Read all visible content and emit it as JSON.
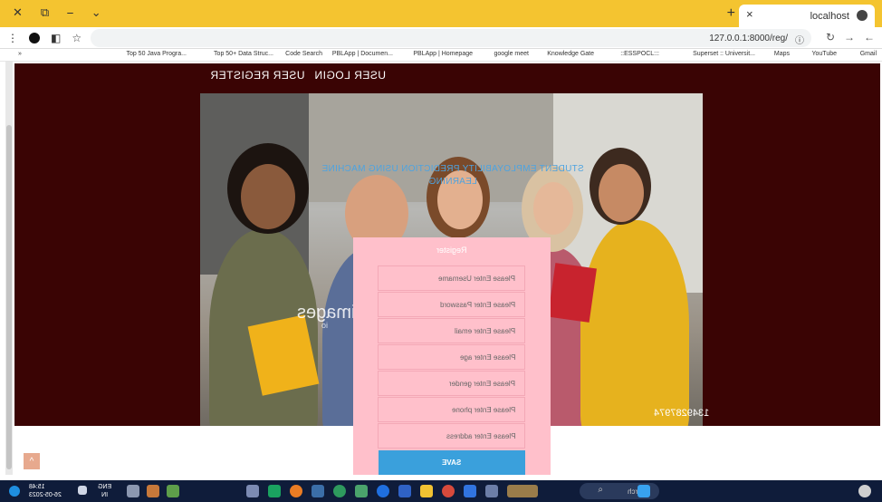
{
  "browser": {
    "tab_title": "localhost",
    "url": "127.0.0.1:8000/reg/",
    "new_tab": "+",
    "close_tab": "×",
    "window_controls": [
      "✕",
      "⎯",
      "⌄"
    ],
    "bookmarks": [
      "Gmail",
      "YouTube",
      "Maps",
      "Superset :: Universit...",
      "::ESSPOCL:::",
      "Knowledge Gate",
      "google meet",
      "PBLApp | Homepage",
      "PBLApp | Documen...",
      "Code Search",
      "Top 50+ Data Struc...",
      "Top 50 Java Progra...",
      "»"
    ]
  },
  "nav": {
    "menu_items": [
      "USER LOGIN",
      "USER REGISTER"
    ]
  },
  "hero": {
    "heading": "STUDENT EMPLOYABILITY PREDICTION USING MACHINE LEARNING",
    "watermark": "images",
    "watermark_sub": "io",
    "image_id": "1349287974"
  },
  "form": {
    "title": "Register",
    "fields": [
      {
        "name": "username",
        "placeholder": "Please Enter Username"
      },
      {
        "name": "password",
        "placeholder": "Please Enter Password"
      },
      {
        "name": "email",
        "placeholder": "Please Enter email"
      },
      {
        "name": "age",
        "placeholder": "Please Enter age"
      },
      {
        "name": "gender",
        "placeholder": "Please Enter gender"
      },
      {
        "name": "phone",
        "placeholder": "Please Enter phone"
      },
      {
        "name": "address",
        "placeholder": "Please Enter address"
      }
    ],
    "submit_label": "SAVE"
  },
  "scroll_top_label": "^",
  "taskbar": {
    "search_label": "Search",
    "time": "15:48",
    "date": "26-05-2023",
    "lang_top": "ENG",
    "lang_bottom": "IN"
  },
  "colors": {
    "tab_bar": "#f4c430",
    "hero_bg": "#3a0404",
    "form_bg": "#ffc0cb",
    "save_button": "#3aa0dc",
    "heading": "#4da3e0",
    "taskbar": "#0f1c3a"
  }
}
